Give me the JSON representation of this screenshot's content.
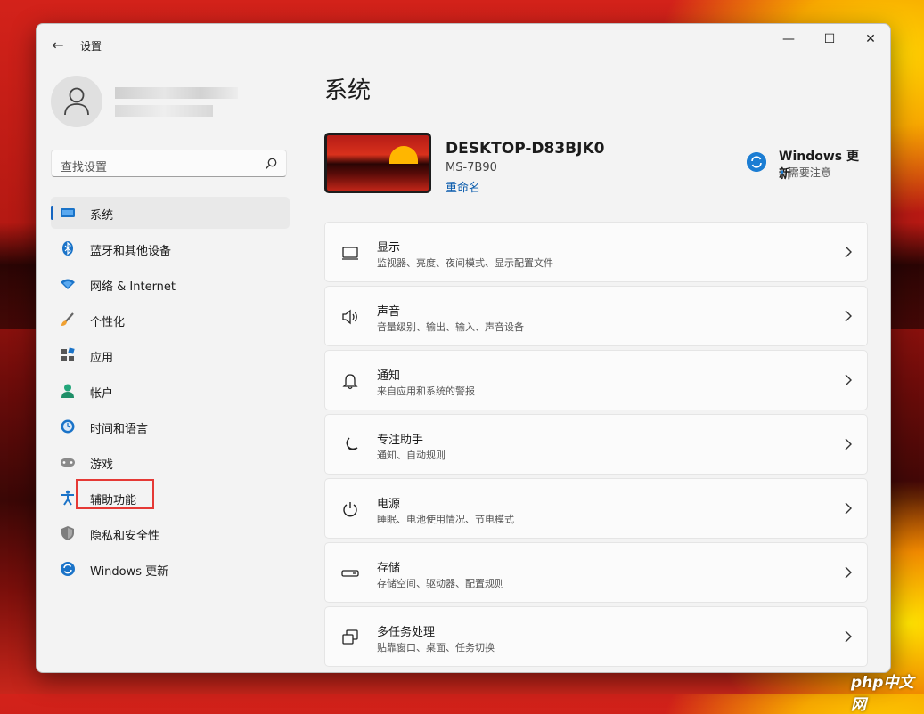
{
  "titlebar": {
    "app_title": "设置",
    "back_label": "←",
    "minimize_label": "—",
    "maximize_label": "☐",
    "close_label": "✕"
  },
  "search": {
    "placeholder": "查找设置"
  },
  "sidebar": {
    "items": [
      {
        "label": "系统",
        "icon": "system-icon",
        "active": true
      },
      {
        "label": "蓝牙和其他设备",
        "icon": "bluetooth-icon"
      },
      {
        "label": "网络 & Internet",
        "icon": "wifi-icon"
      },
      {
        "label": "个性化",
        "icon": "brush-icon"
      },
      {
        "label": "应用",
        "icon": "apps-icon"
      },
      {
        "label": "帐户",
        "icon": "account-icon"
      },
      {
        "label": "时间和语言",
        "icon": "time-language-icon"
      },
      {
        "label": "游戏",
        "icon": "gaming-icon"
      },
      {
        "label": "辅助功能",
        "icon": "accessibility-icon",
        "highlighted": true
      },
      {
        "label": "隐私和安全性",
        "icon": "shield-icon"
      },
      {
        "label": "Windows 更新",
        "icon": "windows-update-icon"
      }
    ]
  },
  "main": {
    "title": "系统",
    "device": {
      "name": "DESKTOP-D83BJK0",
      "model": "MS-7B90",
      "rename_label": "重命名"
    },
    "windows_update": {
      "title": "Windows 更新",
      "status": "需要注意"
    },
    "cards": [
      {
        "title": "显示",
        "subtitle": "监视器、亮度、夜间模式、显示配置文件",
        "icon": "display-icon"
      },
      {
        "title": "声音",
        "subtitle": "音量级别、输出、输入、声音设备",
        "icon": "speaker-icon"
      },
      {
        "title": "通知",
        "subtitle": "来自应用和系统的警报",
        "icon": "bell-icon"
      },
      {
        "title": "专注助手",
        "subtitle": "通知、自动规则",
        "icon": "moon-icon"
      },
      {
        "title": "电源",
        "subtitle": "睡眠、电池使用情况、节电模式",
        "icon": "power-icon"
      },
      {
        "title": "存储",
        "subtitle": "存储空间、驱动器、配置规则",
        "icon": "storage-icon"
      },
      {
        "title": "多任务处理",
        "subtitle": "贴靠窗口、桌面、任务切换",
        "icon": "multitasking-icon"
      }
    ]
  },
  "colors": {
    "accent": "#0067c0",
    "highlight_box": "#e53935",
    "window_bg": "#f3f3f3"
  },
  "watermark": "php中文网"
}
